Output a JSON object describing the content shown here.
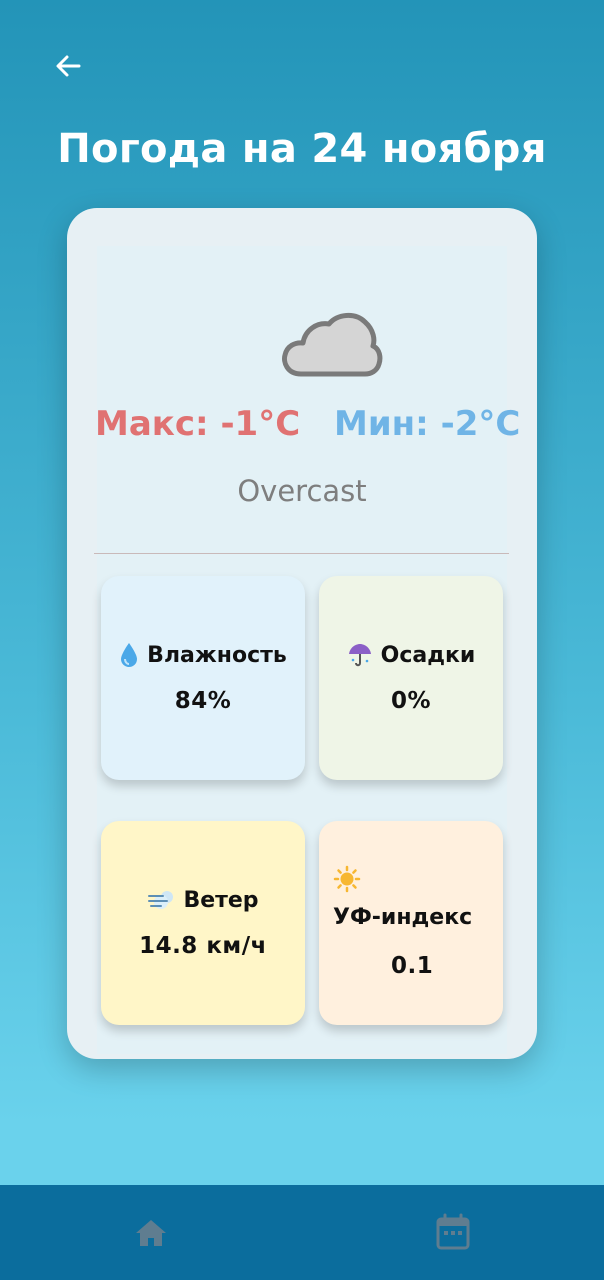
{
  "header": {
    "title": "Погода на 24 ноября",
    "back_icon": "arrow-left-icon"
  },
  "weather": {
    "condition_icon": "cloud-icon",
    "max_temp": "Макс: -1°C",
    "min_temp": "Мин: -2°C",
    "condition": "Overcast"
  },
  "details": {
    "humidity": {
      "icon": "droplet-icon",
      "label": "Влажность",
      "value": "84%"
    },
    "precipitation": {
      "icon": "umbrella-icon",
      "label": "Осадки",
      "value": "0%"
    },
    "wind": {
      "icon": "wind-icon",
      "label": "Ветер",
      "value": "14.8 км/ч"
    },
    "uv": {
      "icon": "sun-icon",
      "label": "УФ-индекс",
      "value": "0.1"
    }
  },
  "bottom_nav": {
    "items": [
      {
        "icon": "home-icon"
      },
      {
        "icon": "calendar-icon"
      }
    ]
  },
  "colors": {
    "max_temp": "#e07272",
    "min_temp": "#6fb4e6",
    "nav_bar": "#0b6d9d",
    "nav_icon": "#5f7d90"
  }
}
